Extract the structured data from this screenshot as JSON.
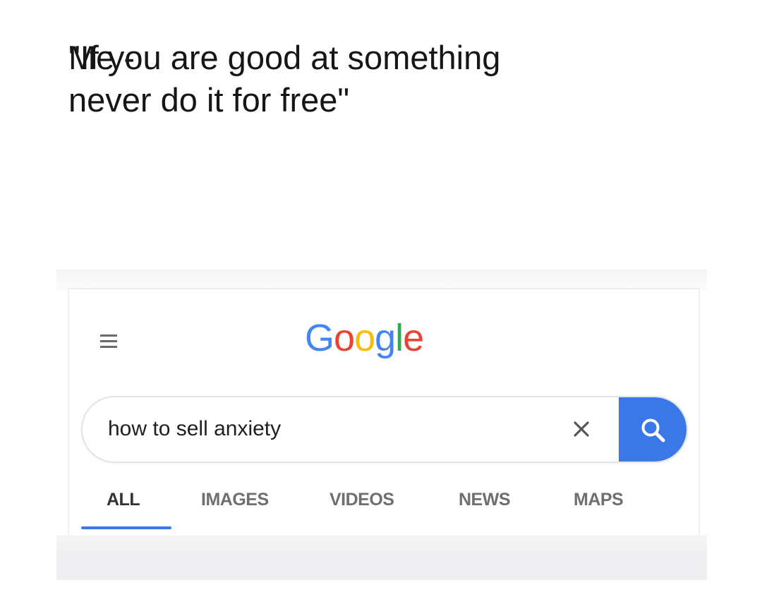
{
  "caption": {
    "line1": "\"If you are good at something",
    "line2": "never do it for free\"",
    "me": "Me -"
  },
  "google": {
    "logo": {
      "letters": [
        "G",
        "o",
        "o",
        "g",
        "l",
        "e"
      ],
      "colors": [
        "#4285f4",
        "#ea4335",
        "#fbbc05",
        "#4285f4",
        "#34a853",
        "#ea4335"
      ]
    },
    "menu_icon": "hamburger-menu-icon",
    "search": {
      "value": "how to sell anxiety",
      "clear_icon": "close-icon",
      "search_icon": "magnifier-icon",
      "button_color": "#3b78e7"
    },
    "tabs": [
      {
        "label": "ALL",
        "active": true
      },
      {
        "label": "IMAGES",
        "active": false
      },
      {
        "label": "VIDEOS",
        "active": false
      },
      {
        "label": "NEWS",
        "active": false
      },
      {
        "label": "MAPS",
        "active": false
      }
    ],
    "accent": "#3b78e7"
  }
}
